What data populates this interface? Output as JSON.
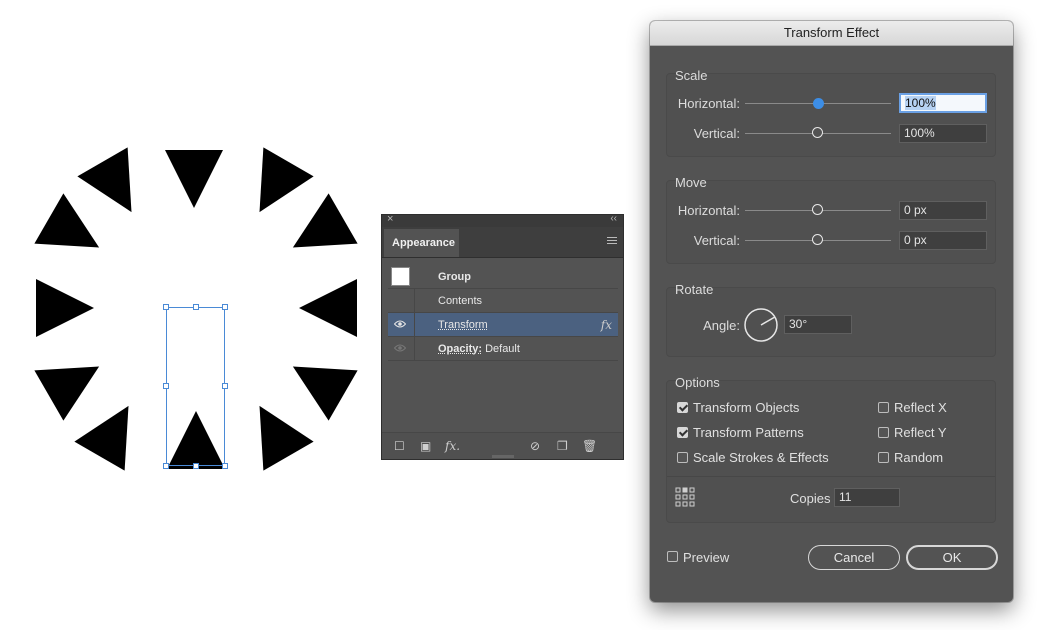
{
  "appearance": {
    "tab_label": "Appearance",
    "rows": [
      {
        "label": "Group"
      },
      {
        "label": "Contents"
      },
      {
        "label": "Transform",
        "fx": "fx"
      },
      {
        "label_bold": "Opacity:",
        "label_rest": " Default"
      }
    ],
    "fx_footer": "fx."
  },
  "dialog": {
    "title": "Transform Effect",
    "scale": {
      "label": "Scale",
      "horizontal_label": "Horizontal:",
      "horizontal_value": "100%",
      "vertical_label": "Vertical:",
      "vertical_value": "100%"
    },
    "move": {
      "label": "Move",
      "horizontal_label": "Horizontal:",
      "horizontal_value": "0 px",
      "vertical_label": "Vertical:",
      "vertical_value": "0 px"
    },
    "rotate": {
      "label": "Rotate",
      "angle_label": "Angle:",
      "angle_value": "30°"
    },
    "options": {
      "label": "Options",
      "transform_objects": "Transform Objects",
      "transform_objects_checked": true,
      "transform_patterns": "Transform Patterns",
      "transform_patterns_checked": true,
      "scale_strokes": "Scale Strokes & Effects",
      "scale_strokes_checked": false,
      "reflect_x": "Reflect X",
      "reflect_x_checked": false,
      "reflect_y": "Reflect Y",
      "reflect_y_checked": false,
      "random": "Random",
      "random_checked": false,
      "copies_label": "Copies",
      "copies_value": "11"
    },
    "preview_label": "Preview",
    "preview_checked": false,
    "cancel_label": "Cancel",
    "ok_label": "OK"
  },
  "colors": {
    "panel_bg": "#535353",
    "selection": "#4a8ad6",
    "slider_active": "#3d8ee6",
    "row_selected": "#4b6180"
  }
}
